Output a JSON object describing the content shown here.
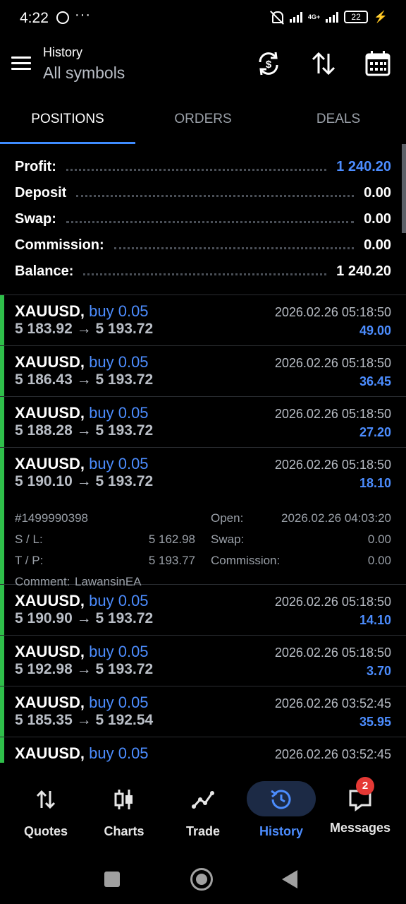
{
  "status_bar": {
    "time": "4:22",
    "network": "4G+",
    "battery": "22",
    "icons": [
      "whatsapp-icon",
      "more-dots-icon",
      "mute-icon",
      "signal-icon",
      "battery-icon",
      "charging-icon"
    ]
  },
  "header": {
    "title": "History",
    "subtitle": "All symbols",
    "icons": [
      "menu-icon",
      "sync-icon",
      "sort-icon",
      "calendar-icon"
    ]
  },
  "tabs": [
    {
      "label": "POSITIONS",
      "active": true
    },
    {
      "label": "ORDERS",
      "active": false
    },
    {
      "label": "DEALS",
      "active": false
    }
  ],
  "summary": {
    "profit_label": "Profit:",
    "profit_value": "1 240.20",
    "deposit_label": "Deposit",
    "deposit_value": "0.00",
    "swap_label": "Swap:",
    "swap_value": "0.00",
    "commission_label": "Commission:",
    "commission_value": "0.00",
    "balance_label": "Balance:",
    "balance_value": "1 240.20"
  },
  "positions": [
    {
      "symbol": "XAUUSD,",
      "side": "buy 0.05",
      "open_price": "5 183.92",
      "close_price": "5 193.72",
      "time": "2026.02.26 05:18:50",
      "profit": "49.00"
    },
    {
      "symbol": "XAUUSD,",
      "side": "buy 0.05",
      "open_price": "5 186.43",
      "close_price": "5 193.72",
      "time": "2026.02.26 05:18:50",
      "profit": "36.45"
    },
    {
      "symbol": "XAUUSD,",
      "side": "buy 0.05",
      "open_price": "5 188.28",
      "close_price": "5 193.72",
      "time": "2026.02.26 05:18:50",
      "profit": "27.20"
    },
    {
      "symbol": "XAUUSD,",
      "side": "buy 0.05",
      "open_price": "5 190.10",
      "close_price": "5 193.72",
      "time": "2026.02.26 05:18:50",
      "profit": "18.10",
      "details": {
        "ticket": "#1499990398",
        "sl_label": "S / L:",
        "sl_value": "5 162.98",
        "tp_label": "T / P:",
        "tp_value": "5 193.77",
        "open_label": "Open:",
        "open_value": "2026.02.26 04:03:20",
        "swap_label": "Swap:",
        "swap_value": "0.00",
        "commission_label": "Commission:",
        "commission_value": "0.00",
        "comment_label": "Comment:",
        "comment_value": "LawansinEA"
      }
    },
    {
      "symbol": "XAUUSD,",
      "side": "buy 0.05",
      "open_price": "5 190.90",
      "close_price": "5 193.72",
      "time": "2026.02.26 05:18:50",
      "profit": "14.10"
    },
    {
      "symbol": "XAUUSD,",
      "side": "buy 0.05",
      "open_price": "5 192.98",
      "close_price": "5 193.72",
      "time": "2026.02.26 05:18:50",
      "profit": "3.70"
    },
    {
      "symbol": "XAUUSD,",
      "side": "buy 0.05",
      "open_price": "5 185.35",
      "close_price": "5 192.54",
      "time": "2026.02.26 03:52:45",
      "profit": "35.95"
    },
    {
      "symbol": "XAUUSD,",
      "side": "buy 0.05",
      "open_price": "",
      "close_price": "",
      "time": "2026.02.26 03:52:45",
      "profit": ""
    }
  ],
  "arrow": "→",
  "bottom_nav": [
    {
      "label": "Quotes",
      "icon": "quotes-icon",
      "active": false
    },
    {
      "label": "Charts",
      "icon": "charts-icon",
      "active": false
    },
    {
      "label": "Trade",
      "icon": "trade-icon",
      "active": false
    },
    {
      "label": "History",
      "icon": "history-icon",
      "active": true
    },
    {
      "label": "Messages",
      "icon": "messages-icon",
      "active": false,
      "badge": "2"
    }
  ],
  "colors": {
    "accent": "#4c8dff",
    "profit_bar": "#2fbf4a",
    "background": "#000000",
    "badge": "#e53935"
  }
}
